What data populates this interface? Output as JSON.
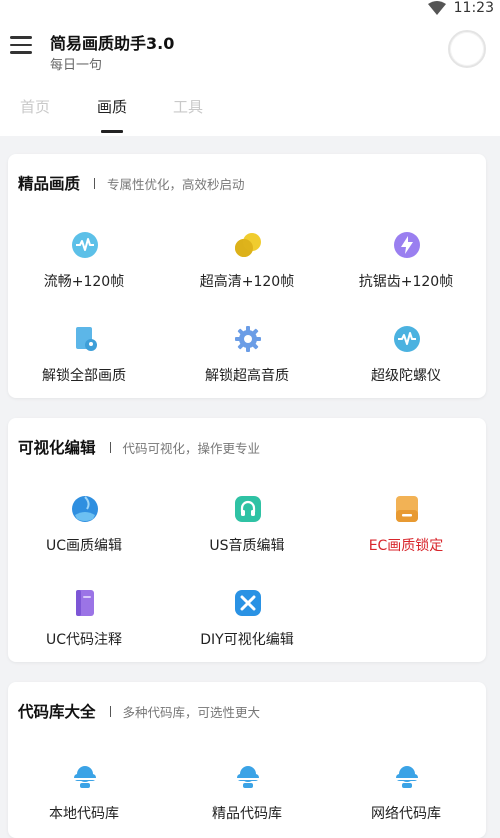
{
  "status_bar": {
    "time": "11:23",
    "icon": "wifi-icon"
  },
  "app_bar": {
    "title": "简易画质助手3.0",
    "subtitle": "每日一句"
  },
  "tabs": [
    {
      "label": "首页",
      "active": false
    },
    {
      "label": "画质",
      "active": true
    },
    {
      "label": "工具",
      "active": false
    }
  ],
  "sections": [
    {
      "title": "精品画质",
      "subtitle": "专属性优化，高效秒启动",
      "items": [
        {
          "label": "流畅+120帧",
          "icon": "pulse-icon"
        },
        {
          "label": "超高清+120帧",
          "icon": "coins-icon"
        },
        {
          "label": "抗锯齿+120帧",
          "icon": "lightning-icon"
        },
        {
          "label": "解锁全部画质",
          "icon": "file-location-icon"
        },
        {
          "label": "解锁超高音质",
          "icon": "gear-icon"
        },
        {
          "label": "超级陀螺仪",
          "icon": "pulse-icon"
        }
      ]
    },
    {
      "title": "可视化编辑",
      "subtitle": "代码可视化，操作更专业",
      "items": [
        {
          "label": "UC画质编辑",
          "icon": "globe-icon"
        },
        {
          "label": "US音质编辑",
          "icon": "headphones-icon"
        },
        {
          "label": "EC画质锁定",
          "icon": "card-icon",
          "color": "#d8262c"
        },
        {
          "label": "UC代码注释",
          "icon": "book-icon"
        },
        {
          "label": "DIY可视化编辑",
          "icon": "tools-icon"
        }
      ]
    },
    {
      "title": "代码库大全",
      "subtitle": "多种代码库，可选性更大",
      "items": [
        {
          "label": "本地代码库",
          "icon": "cloud-icon"
        },
        {
          "label": "精品代码库",
          "icon": "cloud-icon"
        },
        {
          "label": "网络代码库",
          "icon": "cloud-icon"
        }
      ]
    }
  ]
}
